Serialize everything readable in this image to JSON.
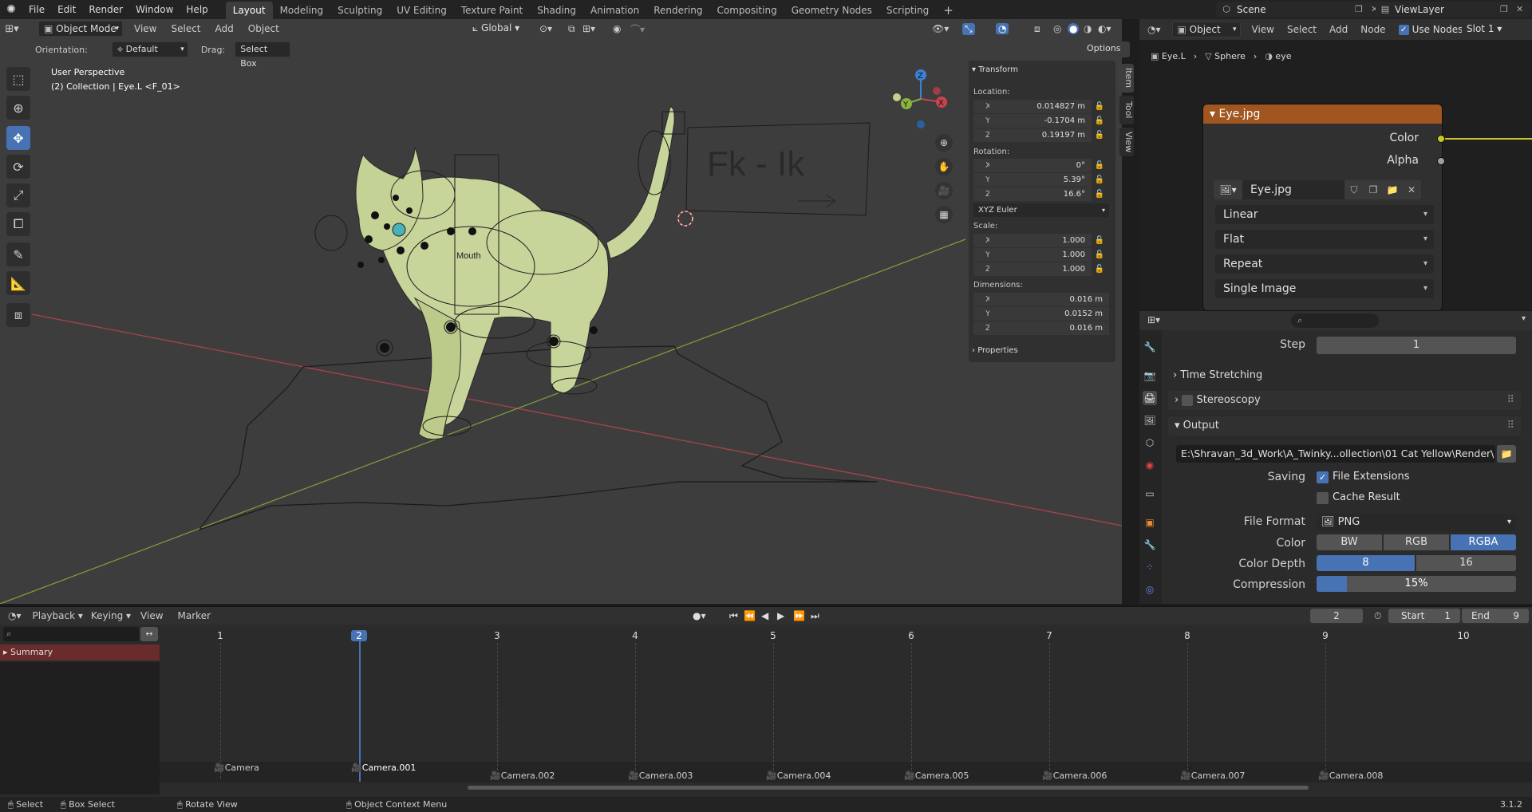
{
  "topbar": {
    "menus": [
      "File",
      "Edit",
      "Render",
      "Window",
      "Help"
    ],
    "workspaces": [
      "Layout",
      "Modeling",
      "Sculpting",
      "UV Editing",
      "Texture Paint",
      "Shading",
      "Animation",
      "Rendering",
      "Compositing",
      "Geometry Nodes",
      "Scripting"
    ],
    "active_workspace": "Layout",
    "add_tab": "+",
    "scene": "Scene",
    "view_layer": "ViewLayer"
  },
  "viewport": {
    "mode": "Object Mode",
    "menus": [
      "View",
      "Select",
      "Add",
      "Object"
    ],
    "transform_orientation": "Global",
    "orientation_label": "Orientation:",
    "orientation_value": "Default",
    "drag_label": "Drag:",
    "drag_value": "Select Box",
    "options": "Options",
    "overlay_title": "User Perspective",
    "overlay_sub": "(2) Collection | Eye.L <F_01>",
    "scene_text_fk": "Fk  -  Ik",
    "scene_text_mouth": "Mouth",
    "gizmo_axes": {
      "x": "X",
      "y": "Y",
      "z": "Z"
    }
  },
  "npanel": {
    "header": "Transform",
    "location_label": "Location:",
    "location": {
      "x": "0.014827 m",
      "y": "-0.1704 m",
      "z": "0.19197 m"
    },
    "rotation_label": "Rotation:",
    "rotation": {
      "x": "0°",
      "y": "5.39°",
      "z": "16.6°"
    },
    "rotation_mode": "XYZ Euler",
    "scale_label": "Scale:",
    "scale": {
      "x": "1.000",
      "y": "1.000",
      "z": "1.000"
    },
    "dimensions_label": "Dimensions:",
    "dimensions": {
      "x": "0.016 m",
      "y": "0.0152 m",
      "z": "0.016 m"
    },
    "properties": "Properties",
    "tabs": [
      "Item",
      "Tool",
      "View"
    ]
  },
  "node_editor": {
    "mode": "Object",
    "menus": [
      "View",
      "Select",
      "Add",
      "Node"
    ],
    "use_nodes": "Use Nodes",
    "slot": "Slot 1",
    "breadcrumb": [
      "Eye.L",
      "Sphere",
      "eye"
    ],
    "node": {
      "title": "Eye.jpg",
      "header_color": "#a0561e",
      "outputs": [
        "Color",
        "Alpha"
      ],
      "image_name": "Eye.jpg",
      "interpolation": "Linear",
      "projection": "Flat",
      "extension": "Repeat",
      "source": "Single Image"
    }
  },
  "properties": {
    "step_label": "Step",
    "step_value": "1",
    "time_stretching": "Time Stretching",
    "stereoscopy": "Stereoscopy",
    "output": "Output",
    "output_path": "E:\\Shravan_3d_Work\\A_Twinky...ollection\\01 Cat Yellow\\Render\\",
    "saving_label": "Saving",
    "file_extensions": "File Extensions",
    "cache_result": "Cache Result",
    "file_format_label": "File Format",
    "file_format": "PNG",
    "color_label": "Color",
    "color_options": [
      "BW",
      "RGB",
      "RGBA"
    ],
    "color_selected": "RGBA",
    "color_depth_label": "Color Depth",
    "color_depth_options": [
      "8",
      "16"
    ],
    "color_depth_selected": "8",
    "compression_label": "Compression",
    "compression_value": "15%",
    "compression_fraction": 0.15
  },
  "timeline": {
    "menus": [
      "Playback",
      "Keying",
      "View",
      "Marker"
    ],
    "current_frame": "2",
    "start_label": "Start",
    "start": "1",
    "end_label": "End",
    "end": "9",
    "summary": "Summary",
    "frame_numbers": [
      "1",
      "2",
      "3",
      "4",
      "5",
      "6",
      "7",
      "8",
      "9",
      "10"
    ],
    "markers": [
      "Camera",
      "Camera.001",
      "Camera.002",
      "Camera.003",
      "Camera.004",
      "Camera.005",
      "Camera.006",
      "Camera.007",
      "Camera.008"
    ]
  },
  "statusbar": {
    "select": "Select",
    "box_select": "Box Select",
    "rotate_view": "Rotate View",
    "context_menu": "Object Context Menu",
    "version": "3.1.2"
  },
  "colors": {
    "accent": "#4772b3",
    "x_axis": "#c8434f",
    "y_axis": "#8cb240",
    "z_axis": "#3b82d6"
  }
}
